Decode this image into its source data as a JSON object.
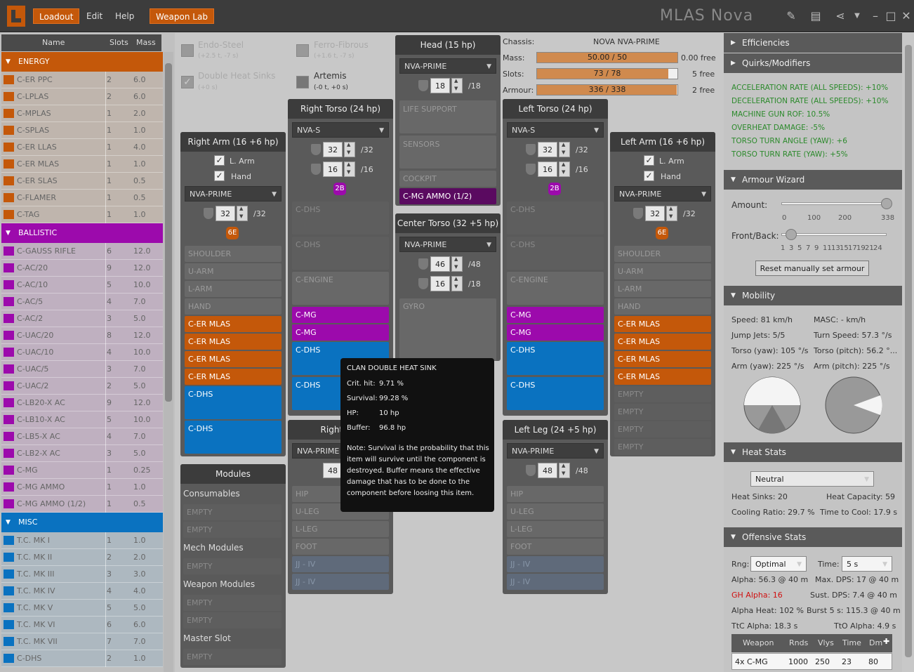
{
  "app": {
    "title": "MLAS Nova",
    "menu": [
      "Loadout",
      "Edit",
      "Help"
    ],
    "weapon_lab": "Weapon Lab"
  },
  "equipment": {
    "headers": {
      "name": "Name",
      "slots": "Slots",
      "mass": "Mass"
    },
    "categories": [
      {
        "name": "ENERGY",
        "color": "#c4580a",
        "rowbg": "#bfb5ad",
        "items": [
          {
            "name": "C-ER PPC",
            "slots": "2",
            "mass": "6.0"
          },
          {
            "name": "C-LPLAS",
            "slots": "2",
            "mass": "6.0"
          },
          {
            "name": "C-MPLAS",
            "slots": "1",
            "mass": "2.0"
          },
          {
            "name": "C-SPLAS",
            "slots": "1",
            "mass": "1.0"
          },
          {
            "name": "C-ER LLAS",
            "slots": "1",
            "mass": "4.0"
          },
          {
            "name": "C-ER MLAS",
            "slots": "1",
            "mass": "1.0"
          },
          {
            "name": "C-ER SLAS",
            "slots": "1",
            "mass": "0.5"
          },
          {
            "name": "C-FLAMER",
            "slots": "1",
            "mass": "0.5"
          },
          {
            "name": "C-TAG",
            "slots": "1",
            "mass": "1.0"
          }
        ]
      },
      {
        "name": "BALLISTIC",
        "color": "#9c0aac",
        "rowbg": "#bfb0c0",
        "items": [
          {
            "name": "C-GAUSS RIFLE",
            "slots": "6",
            "mass": "12.0"
          },
          {
            "name": "C-AC/20",
            "slots": "9",
            "mass": "12.0"
          },
          {
            "name": "C-AC/10",
            "slots": "5",
            "mass": "10.0"
          },
          {
            "name": "C-AC/5",
            "slots": "4",
            "mass": "7.0"
          },
          {
            "name": "C-AC/2",
            "slots": "3",
            "mass": "5.0"
          },
          {
            "name": "C-UAC/20",
            "slots": "8",
            "mass": "12.0"
          },
          {
            "name": "C-UAC/10",
            "slots": "4",
            "mass": "10.0"
          },
          {
            "name": "C-UAC/5",
            "slots": "3",
            "mass": "7.0"
          },
          {
            "name": "C-UAC/2",
            "slots": "2",
            "mass": "5.0"
          },
          {
            "name": "C-LB20-X AC",
            "slots": "9",
            "mass": "12.0"
          },
          {
            "name": "C-LB10-X AC",
            "slots": "5",
            "mass": "10.0"
          },
          {
            "name": "C-LB5-X AC",
            "slots": "4",
            "mass": "7.0"
          },
          {
            "name": "C-LB2-X AC",
            "slots": "3",
            "mass": "5.0"
          },
          {
            "name": "C-MG",
            "slots": "1",
            "mass": "0.25"
          },
          {
            "name": "C-MG AMMO",
            "slots": "1",
            "mass": "1.0"
          },
          {
            "name": "C-MG AMMO (1/2)",
            "slots": "1",
            "mass": "0.5"
          }
        ]
      },
      {
        "name": "MISC",
        "color": "#0a72c0",
        "rowbg": "#adb8c0",
        "items": [
          {
            "name": "T.C. MK I",
            "slots": "1",
            "mass": "1.0"
          },
          {
            "name": "T.C. MK II",
            "slots": "2",
            "mass": "2.0"
          },
          {
            "name": "T.C. MK III",
            "slots": "3",
            "mass": "3.0"
          },
          {
            "name": "T.C. MK IV",
            "slots": "4",
            "mass": "4.0"
          },
          {
            "name": "T.C. MK V",
            "slots": "5",
            "mass": "5.0"
          },
          {
            "name": "T.C. MK VI",
            "slots": "6",
            "mass": "6.0"
          },
          {
            "name": "T.C. MK VII",
            "slots": "7",
            "mass": "7.0"
          },
          {
            "name": "C-DHS",
            "slots": "2",
            "mass": "1.0"
          }
        ]
      }
    ]
  },
  "upgrades": {
    "endo": "Endo-Steel",
    "endo_sub": "(+2.5 t, -7 s)",
    "ferro": "Ferro-Fibrous",
    "ferro_sub": "(+1.6 t, -7 s)",
    "dhs": "Double Heat Sinks",
    "dhs_sub": "(+0 s)",
    "artemis": "Artemis",
    "artemis_sub": "(-0 t, +0 s)"
  },
  "chassis": {
    "chassis_label": "Chassis:",
    "chassis": "NOVA NVA-PRIME",
    "mass_label": "Mass:",
    "mass": "50.00 / 50",
    "mass_free": "0.00 free",
    "slots_label": "Slots:",
    "slots": "73 / 78",
    "slots_free": "5 free",
    "armour_label": "Armour:",
    "armour": "336 / 338",
    "armour_free": "2 free",
    "mass_frac": 1.0,
    "slots_frac": 0.936,
    "armour_frac": 0.994
  },
  "parts": {
    "head": {
      "title": "Head (15 hp)",
      "omni": "NVA-PRIME",
      "armor": "18",
      "armor_max": "/18",
      "slots": [
        "LIFE SUPPORT",
        "SENSORS",
        "COCKPIT",
        "C-MG AMMO (1/2)"
      ]
    },
    "rt": {
      "title": "Right Torso (24 hp)",
      "omni": "NVA-S",
      "front": "32",
      "front_max": "/32",
      "back": "16",
      "back_max": "/16",
      "hp": "2B",
      "slots": [
        "C-DHS",
        "C-DHS",
        "C-ENGINE",
        "C-MG",
        "C-MG",
        "C-DHS",
        "C-DHS"
      ]
    },
    "lt": {
      "title": "Left Torso (24 hp)",
      "omni": "NVA-S",
      "front": "32",
      "front_max": "/32",
      "back": "16",
      "back_max": "/16",
      "hp": "2B",
      "slots": [
        "C-DHS",
        "C-DHS",
        "C-ENGINE",
        "C-MG",
        "C-MG",
        "C-DHS",
        "C-DHS"
      ]
    },
    "ct": {
      "title": "Center Torso (32 +5 hp)",
      "omni": "NVA-PRIME",
      "front": "46",
      "front_max": "/48",
      "back": "16",
      "back_max": "/18",
      "slots": [
        "GYRO"
      ]
    },
    "ra": {
      "title": "Right Arm (16 +6 hp)",
      "omni": "NVA-PRIME",
      "larm": "L. Arm",
      "hand": "Hand",
      "armor": "32",
      "armor_max": "/32",
      "hp": "6E",
      "slots": [
        "SHOULDER",
        "U-ARM",
        "L-ARM",
        "HAND",
        "C-ER MLAS",
        "C-ER MLAS",
        "C-ER MLAS",
        "C-ER MLAS",
        "C-DHS",
        "C-DHS"
      ]
    },
    "la": {
      "title": "Left Arm (16 +6 hp)",
      "omni": "NVA-PRIME",
      "larm": "L. Arm",
      "hand": "Hand",
      "armor": "32",
      "armor_max": "/32",
      "hp": "6E",
      "slots": [
        "SHOULDER",
        "U-ARM",
        "L-ARM",
        "HAND",
        "C-ER MLAS",
        "C-ER MLAS",
        "C-ER MLAS",
        "C-ER MLAS",
        "EMPTY",
        "EMPTY",
        "EMPTY",
        "EMPTY"
      ]
    },
    "rl": {
      "title": "Right Leg",
      "omni": "NVA-PRIME",
      "armor": "48",
      "slots": [
        "HIP",
        "U-LEG",
        "L-LEG",
        "FOOT",
        "JJ - IV",
        "JJ - IV"
      ]
    },
    "ll": {
      "title": "Left Leg (24 +5 hp)",
      "omni": "NVA-PRIME",
      "armor": "48",
      "armor_max": "/48",
      "slots": [
        "HIP",
        "U-LEG",
        "L-LEG",
        "FOOT",
        "JJ - IV",
        "JJ - IV"
      ]
    }
  },
  "modules": {
    "title": "Modules",
    "consumables": "Consumables",
    "mech": "Mech Modules",
    "weapon": "Weapon Modules",
    "master": "Master Slot",
    "empty": "EMPTY"
  },
  "tooltip": {
    "title": "CLAN DOUBLE HEAT SINK",
    "crit_l": "Crit. hit:",
    "crit": "9.71 %",
    "surv_l": "Survival:",
    "surv": "99.28 %",
    "hp_l": "HP:",
    "hp": "10 hp",
    "buf_l": "Buffer:",
    "buf": "96.8 hp",
    "note": "Note: Survival is the probability that this item will survive until the component is destroyed. Buffer means the effective damage that has to be done to the component before loosing this item."
  },
  "right": {
    "efficiencies": "Efficiencies",
    "quirks_title": "Quirks/Modifiers",
    "quirks": [
      "ACCELERATION RATE (ALL SPEEDS): +10%",
      "DECELERATION RATE (ALL SPEEDS): +10%",
      "MACHINE GUN ROF: 10.5%",
      "OVERHEAT DAMAGE: -5%",
      "TORSO TURN ANGLE (YAW): +6",
      "TORSO TURN RATE (YAW): +5%"
    ],
    "armour_wizard": "Armour Wizard",
    "amount": "Amount:",
    "amount_ticks": [
      "0",
      "100",
      "200",
      "338"
    ],
    "front_back": "Front/Back:",
    "fb_ticks": [
      "1",
      "3",
      "5",
      "7",
      "9",
      "11",
      "13",
      "15",
      "17",
      "19",
      "21",
      "24"
    ],
    "reset": "Reset manually set armour",
    "mobility": "Mobility",
    "speed": "Speed: 81 km/h",
    "masc": "MASC: - km/h",
    "jump": "Jump Jets: 5/5",
    "turn": "Turn Speed: 57.3 °/s",
    "torso_yaw": "Torso (yaw): 105 °/s",
    "torso_pitch": "Torso (pitch): 56.2 °...",
    "arm_yaw": "Arm (yaw): 225 °/s",
    "arm_pitch": "Arm (pitch): 225 °/s",
    "heat": "Heat Stats",
    "env": "Neutral",
    "sinks": "Heat Sinks: 20",
    "capacity": "Heat Capacity: 59",
    "cooling": "Cooling Ratio: 29.7 %",
    "ttc": "Time to Cool: 17.9 s",
    "off": "Offensive Stats",
    "rng_l": "Rng:",
    "rng": "Optimal",
    "time_l": "Time:",
    "time": "5 s",
    "alpha": "Alpha: 56.3 @ 40 m",
    "maxdps": "Max. DPS: 17 @ 40 m",
    "gh": "GH Alpha: 16",
    "sust": "Sust. DPS: 7.4 @ 40 m",
    "aheat": "Alpha Heat: 102 %",
    "burst": "Burst 5 s: 115.3 @ 40 m",
    "ttc_alpha": "TtC Alpha: 18.3 s",
    "tto_alpha": "TtO Alpha: 4.9 s",
    "table_headers": [
      "Weapon",
      "Rnds",
      "Vlys",
      "Time",
      "Dm"
    ],
    "table_row": [
      "4x C-MG",
      "1000",
      "250",
      "23",
      "80"
    ]
  }
}
